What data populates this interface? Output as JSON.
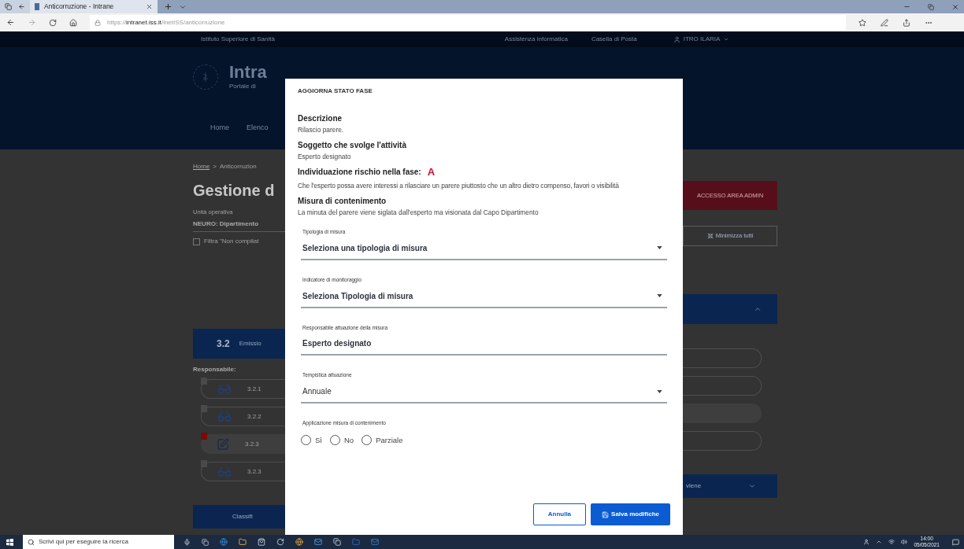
{
  "browser": {
    "tab_title": "Anticorruzione - Intrane",
    "url_prefix": "https://",
    "url_host": "intranet.iss.it",
    "url_path": "/inetISS/anticorruzione"
  },
  "page": {
    "institute": "Istituto Superiore di Sanità",
    "top_links": [
      "Assistenza informatica",
      "Casella di Posta"
    ],
    "user": "ITRO ILARIA",
    "logo_title": "Intra",
    "logo_subtitle": "Portale di",
    "nav": [
      "Home",
      "Elenco"
    ],
    "breadcrumb": {
      "home": "Home",
      "separator": ">",
      "current": "Anticorruzion"
    },
    "title": "Gestione d",
    "admin_button": "ACCESSO AREA ADMIN",
    "unit_label": "Unità operativa",
    "unit_value": "NEURO: Dipartimento",
    "filter": {
      "label": "Filtra \"Non compilat",
      "checked": false
    },
    "minimize_button": "Minimizza tutti",
    "section": {
      "number": "3.2",
      "title": "Emissio",
      "expanded": true
    },
    "responsible_label": "Responsabile:",
    "rows": [
      {
        "code": "3.2.1",
        "kind": "view",
        "flagged": false,
        "selected": false
      },
      {
        "code": "3.2.2",
        "kind": "view",
        "flagged": false,
        "selected": false
      },
      {
        "code": "3.2.3",
        "kind": "edit",
        "flagged": true,
        "selected": true
      },
      {
        "code": "3.2.3",
        "kind": "view",
        "flagged": false,
        "selected": false
      }
    ],
    "next_section": {
      "title": "Classifi",
      "title_right": "viene"
    }
  },
  "modal": {
    "title": "AGGIORNA STATO FASE",
    "details": [
      {
        "label": "Descrizione",
        "value": "Rilascio parere."
      },
      {
        "label": "Soggetto che svolge l'attività",
        "value": "Esperto designato"
      },
      {
        "label": "Individuazione rischio nella fase:",
        "badge": "A",
        "value": "Che l'esperto possa avere interessi a rilasciare un parere piuttosto che un altro dietro compenso, favori o visibilità"
      },
      {
        "label": "Misura di contenimento",
        "value": "La minuta del parere viene siglata dall'esperto ma visionata dal Capo Dipartimento"
      }
    ],
    "fields": [
      {
        "kind": "select",
        "label": "Tipologia di misura",
        "value": "Seleziona una tipologia di misura",
        "emphasized": true
      },
      {
        "kind": "select",
        "label": "Indicatore di monitoraggio",
        "value": "Seleziona Tipologia di misura",
        "emphasized": true
      },
      {
        "kind": "text",
        "label": "Responsabile attuazione della misura",
        "value": "Esperto designato",
        "emphasized": true
      },
      {
        "kind": "select",
        "label": "Tempistica attuazione",
        "value": "Annuale",
        "emphasized": false
      }
    ],
    "radio": {
      "label": "Applicazione misura di contenimento",
      "options": [
        {
          "label": "Sì",
          "selected": false
        },
        {
          "label": "No",
          "selected": false
        },
        {
          "label": "Parziale",
          "selected": false
        }
      ]
    },
    "cancel_button": "Annulla",
    "save_button": "Salva modifiche"
  },
  "taskbar": {
    "search_placeholder": "Scrivi qui per eseguire la ricerca",
    "time": "14:00",
    "date": "05/05/2021"
  }
}
